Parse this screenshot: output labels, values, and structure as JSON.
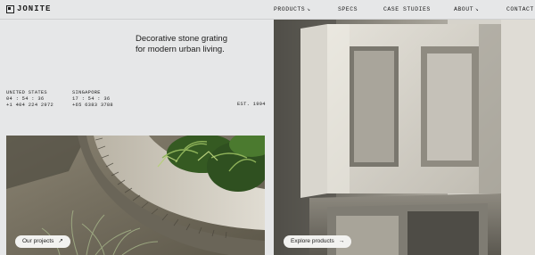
{
  "brand": {
    "name": "JONITE"
  },
  "nav": {
    "items": [
      {
        "label": "PRODUCTS",
        "arrow": "↘"
      },
      {
        "label": "SPECS",
        "arrow": ""
      },
      {
        "label": "CASE STUDIES",
        "arrow": ""
      },
      {
        "label": "ABOUT",
        "arrow": "↘"
      },
      {
        "label": "CONTACT",
        "arrow": ""
      }
    ]
  },
  "hero": {
    "tagline_line1": "Decorative stone grating",
    "tagline_line2": "for modern urban living."
  },
  "offices": [
    {
      "country": "UNITED STATES",
      "time": "04 : 54 : 36",
      "phone": "+1 404 224 2972"
    },
    {
      "country": "SINGAPORE",
      "time": "17 : 54 : 36",
      "phone": "+65 6383 3788"
    }
  ],
  "est": "EST. 1994",
  "cta": {
    "projects_label": "Our projects",
    "projects_icon": "arrow-up-right-icon",
    "products_label": "Explore products",
    "products_icon": "arrow-right-icon"
  }
}
